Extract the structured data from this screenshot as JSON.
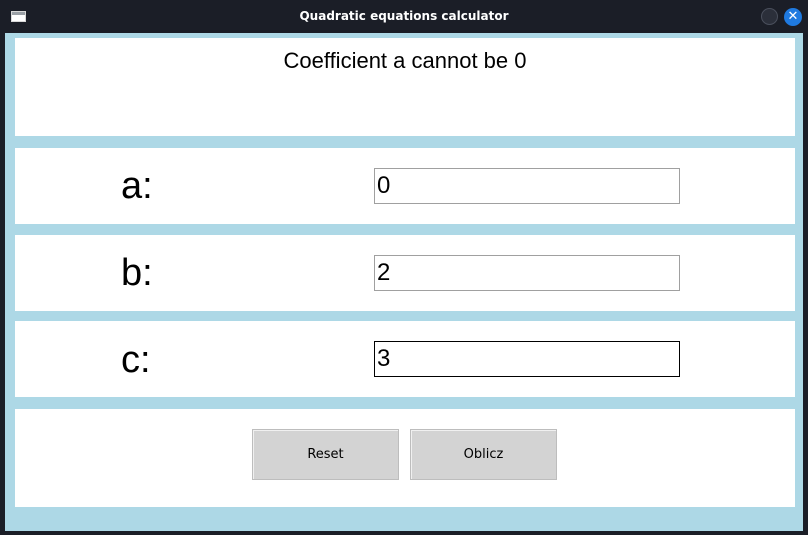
{
  "window": {
    "title": "Quadratic equations calculator"
  },
  "message": "Coefficient a cannot be 0",
  "fields": [
    {
      "label": "a:",
      "value": "0"
    },
    {
      "label": "b:",
      "value": "2"
    },
    {
      "label": "c:",
      "value": "3"
    }
  ],
  "buttons": {
    "reset_label": "Reset",
    "calculate_label": "Oblicz"
  },
  "colors": {
    "background": "#add8e6",
    "panel": "#ffffff",
    "button": "#d3d3d3",
    "titlebar": "#1b1e27",
    "close_button": "#1f7ae0"
  }
}
